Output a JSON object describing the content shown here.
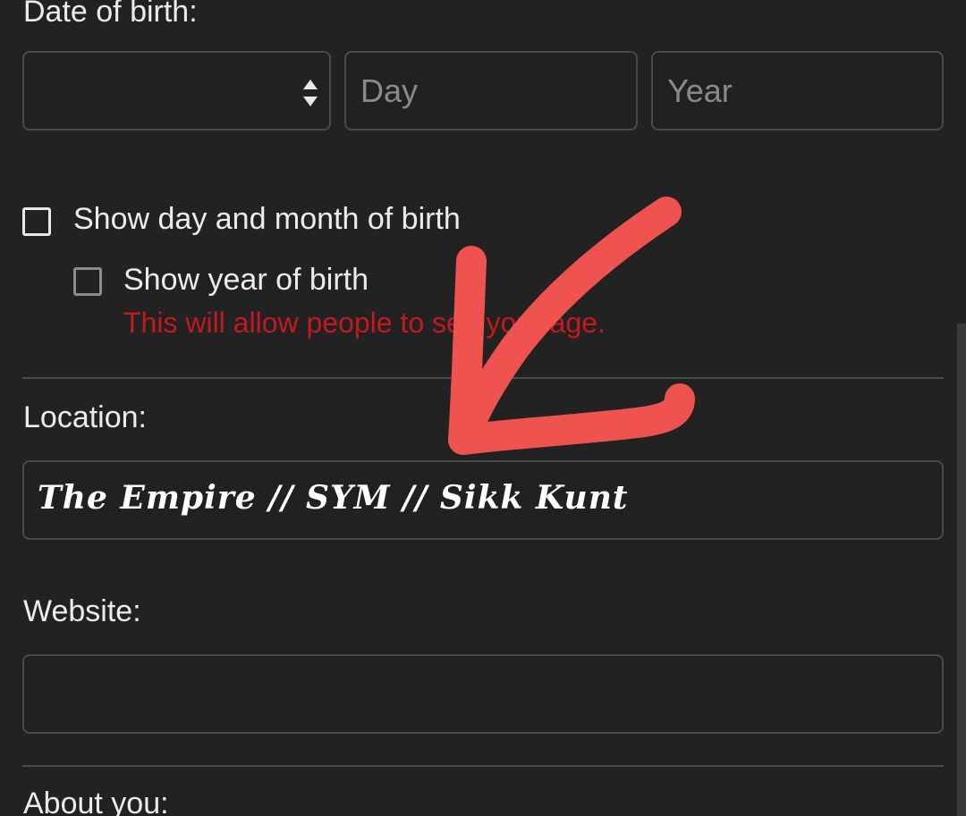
{
  "dob": {
    "label": "Date of birth:",
    "month_value": "",
    "day_placeholder": "Day",
    "year_placeholder": "Year"
  },
  "options": {
    "show_day_month_label": "Show day and month of birth",
    "show_day_month_checked": false,
    "show_year_label": "Show year of birth",
    "show_year_checked": false,
    "warning": "This will allow people to see your age."
  },
  "location": {
    "label": "Location:",
    "value": "The Empire // SYM // Sikk Kunt"
  },
  "website": {
    "label": "Website:",
    "value": ""
  },
  "about": {
    "label": "About you:"
  },
  "colors": {
    "background": "#222223",
    "warning": "#c11a1f",
    "annotation_arrow": "#ef5350"
  },
  "icons": {
    "select_arrows": "up-down-chevron-icon",
    "annotation": "arrow-annotation-icon"
  }
}
